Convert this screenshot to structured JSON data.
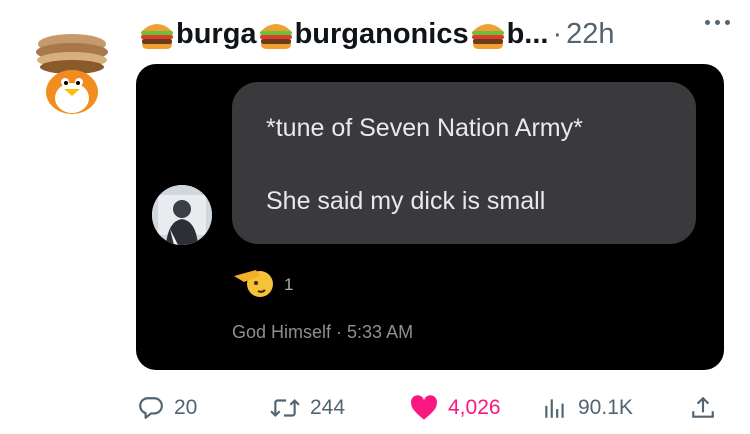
{
  "post": {
    "display_name": "burga",
    "handle": "burganonics",
    "handle_truncated": "b...",
    "separator": "·",
    "time": "22h"
  },
  "message": {
    "line1": "*tune of Seven Nation Army*",
    "line2": "She said my dick is small",
    "reaction_count": "1",
    "footer": "God Himself · 5:33 AM"
  },
  "actions": {
    "replies": "20",
    "reposts": "244",
    "likes": "4,026",
    "views": "90.1K"
  },
  "colors": {
    "like": "#f91880",
    "muted": "#536471",
    "bubble": "#3a3a3c",
    "media_bg": "#000000"
  },
  "icons": [
    "burger-emoji-icon",
    "more-icon",
    "salute-emoji-icon",
    "reply-icon",
    "repost-icon",
    "heart-icon",
    "views-icon",
    "share-icon"
  ]
}
